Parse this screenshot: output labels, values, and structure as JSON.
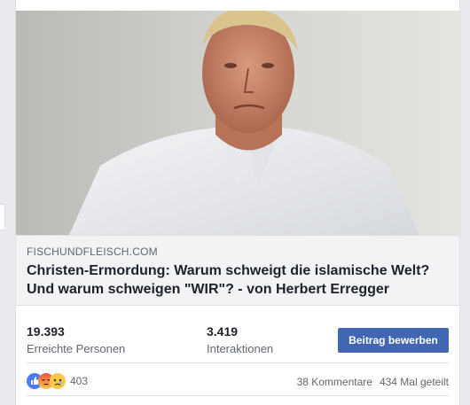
{
  "post": {
    "photo": {
      "alt_icon": "article-photo"
    },
    "link": {
      "domain": "FISCHUNDFLEISCH.COM",
      "headline_line1": "Christen-Ermordung: Warum schweigt die islamische Welt?",
      "headline_line2": "Und warum schweigen \"WIR\"? - von Herbert Erregger"
    },
    "insights": {
      "reach_value": "19.393",
      "reach_label": "Erreichte Personen",
      "engagement_value": "3.419",
      "engagement_label": "Interaktionen",
      "boost_label": "Beitrag bewerben"
    },
    "footer": {
      "reaction_icons": [
        "like-icon",
        "angry-icon",
        "sad-icon"
      ],
      "reaction_count": "403",
      "comments": "38 Kommentare",
      "shares": "434 Mal geteilt"
    }
  },
  "colors": {
    "boost_button": "#4267b2",
    "like": "#4a7cf5",
    "angry": "#f0533b",
    "sad": "#f7c84a"
  }
}
